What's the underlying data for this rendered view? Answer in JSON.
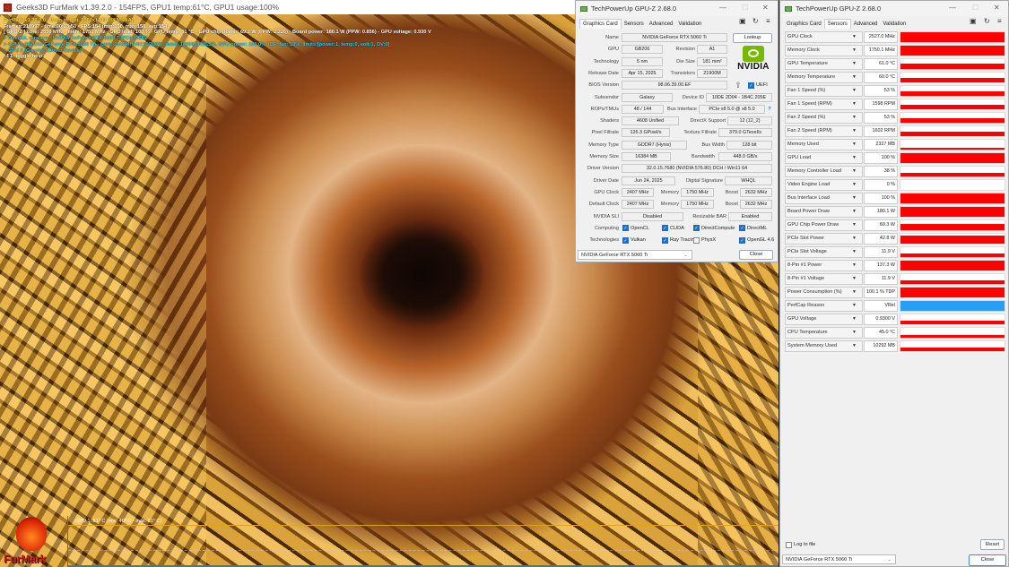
{
  "furmark": {
    "title": "Geeks3D FurMark v1.39.2.0 - 154FPS, GPU1 temp:61°C, GPU1 usage:100%",
    "osd": [
      {
        "c": "y",
        "t": "FurMark v1.39.2.0 - Burn-in test, 2560x1440 (0X MSAA)"
      },
      {
        "c": "w",
        "t": "Frames:218997 - time:00:23:50 - FPS:154 (min:150, max:158, avg:154)"
      },
      {
        "c": "w",
        "t": "[ GPU-Z ] core: 2550 MHz - mem: 1750 MHz - GPU load: 100 % - GPU temp: 61 °C - GPU chip power: 69.2 W (PPW: 2.226) - Board power: 180.1 W (PPW: 0.856) - GPU voltage: 0.930 V"
      },
      {
        "c": "c",
        "t": "> OpenGL renderer: NVIDIA GeForce RTX 5060 Ti/PCIe/SSE2"
      },
      {
        "c": "c",
        "t": "> GPU 1 (NVIDIA GeForce RTX 5060 Ti) - core: 2542MHz/61°C/100%, mem: 14000MHz/13%, GPU power: 100.0% TDP, fan: 53%, limits:[power:1, temp:0, volt:1, OV:0]"
      },
      {
        "c": "c",
        "t": "> GPU 2 (GraphicsDriver Device)"
      },
      {
        "c": "w",
        "t": "- F1: toggle help"
      }
    ],
    "graph_label": "GPU 1: 61° C (min: 40° C - max: 61° C)",
    "logo_text": "FurMark"
  },
  "gpuz1": {
    "title": "TechPowerUp GPU-Z 2.68.0",
    "tabs": [
      "Graphics Card",
      "Sensors",
      "Advanced",
      "Validation"
    ],
    "lookup": "Lookup",
    "vendor_logo": "NVIDIA",
    "rows": [
      {
        "label": "Name",
        "vals": [
          "NVIDIA GeForce RTX 5060 Ti"
        ]
      },
      {
        "label": "GPU",
        "vals": [
          "GB206",
          "Revision",
          "A1"
        ]
      },
      {
        "label": "Technology",
        "vals": [
          "5 nm",
          "Die Size",
          "181 mm²"
        ]
      },
      {
        "label": "Release Date",
        "vals": [
          "Apr 15, 2025",
          "Transistors",
          "21900M"
        ]
      },
      {
        "label": "BIOS Version",
        "vals": [
          "98.06.39.00.EF",
          "UEFI"
        ]
      },
      {
        "label": "Subvendor",
        "vals": [
          "Galaxy",
          "Device ID",
          "10DE 2D04 - 1B4C 205E"
        ]
      },
      {
        "label": "ROPs/TMUs",
        "vals": [
          "48 / 144",
          "Bus Interface",
          "PCIe x8 5.0 @ x8 5.0",
          "?"
        ]
      },
      {
        "label": "Shaders",
        "vals": [
          "4608 Unified",
          "DirectX Support",
          "12 (12_2)"
        ]
      },
      {
        "label": "Pixel Fillrate",
        "vals": [
          "126.3 GPixel/s",
          "Texture Fillrate",
          "379.0 GTexel/s"
        ]
      },
      {
        "label": "Memory Type",
        "vals": [
          "GDDR7 (Hynix)",
          "Bus Width",
          "128 bit"
        ]
      },
      {
        "label": "Memory Size",
        "vals": [
          "16384 MB",
          "Bandwidth",
          "448.0 GB/s"
        ]
      },
      {
        "label": "Driver Version",
        "vals": [
          "32.0.15.7680 (NVIDIA 576.80) DCH / Win11 64"
        ]
      },
      {
        "label": "Driver Date",
        "vals": [
          "Jun 24, 2025",
          "Digital Signature",
          "WHQL"
        ]
      },
      {
        "label": "GPU Clock",
        "vals": [
          "2407 MHz",
          "Memory",
          "1750 MHz",
          "Boost",
          "2632 MHz"
        ]
      },
      {
        "label": "Default Clock",
        "vals": [
          "2407 MHz",
          "Memory",
          "1750 MHz",
          "Boost",
          "2632 MHz"
        ]
      },
      {
        "label": "NVIDIA SLI",
        "vals": [
          "Disabled",
          "Resizable BAR",
          "Enabled"
        ]
      },
      {
        "label": "Computing",
        "checks": [
          {
            "t": "OpenCL",
            "on": true
          },
          {
            "t": "CUDA",
            "on": true
          },
          {
            "t": "DirectCompute",
            "on": true
          },
          {
            "t": "DirectML",
            "on": true
          }
        ]
      },
      {
        "label": "Technologies",
        "checks": [
          {
            "t": "Vulkan",
            "on": true
          },
          {
            "t": "Ray Tracing",
            "on": true
          },
          {
            "t": "PhysX",
            "on": false
          },
          {
            "t": "OpenGL 4.6",
            "on": true
          }
        ]
      }
    ],
    "gpu_select": "NVIDIA GeForce RTX 5060 Ti",
    "close": "Close",
    "uefi_checked": true
  },
  "gpuz2": {
    "title": "TechPowerUp GPU-Z 2.68.0",
    "tabs": [
      "Graphics Card",
      "Sensors",
      "Advanced",
      "Validation"
    ],
    "sensors": [
      {
        "name": "GPU Clock",
        "value": "2527.0 MHz",
        "level": 1.0
      },
      {
        "name": "Memory Clock",
        "value": "1750.1 MHz",
        "level": 1.0
      },
      {
        "name": "GPU Temperature",
        "value": "61.0 °C",
        "level": 0.55
      },
      {
        "name": "Memory Temperature",
        "value": "60.0 °C",
        "level": 0.45
      },
      {
        "name": "Fan 1 Speed (%)",
        "value": "53 %",
        "level": 0.5
      },
      {
        "name": "Fan 1 Speed (RPM)",
        "value": "1598 RPM",
        "level": 0.45
      },
      {
        "name": "Fan 2 Speed (%)",
        "value": "53 %",
        "level": 0.5
      },
      {
        "name": "Fan 2 Speed (RPM)",
        "value": "1602 RPM",
        "level": 0.45
      },
      {
        "name": "Memory Used",
        "value": "2327 MB",
        "level": 0.15
      },
      {
        "name": "GPU Load",
        "value": "100 %",
        "level": 1.0
      },
      {
        "name": "Memory Controller Load",
        "value": "38 %",
        "level": 0.35
      },
      {
        "name": "Video Engine Load",
        "value": "0 %",
        "level": 0
      },
      {
        "name": "Bus Interface Load",
        "value": "100 %",
        "level": 1.0
      },
      {
        "name": "Board Power Draw",
        "value": "180.1 W",
        "level": 1.0
      },
      {
        "name": "GPU Chip Power Draw",
        "value": "69.3 W",
        "level": 0.6
      },
      {
        "name": "PCIe Slot Power",
        "value": "42.8 W",
        "level": 0.85
      },
      {
        "name": "PCIe Slot Voltage",
        "value": "11.9 V",
        "level": 0.4
      },
      {
        "name": "8-Pin #1 Power",
        "value": "137.3 W",
        "level": 1.0
      },
      {
        "name": "8-Pin #1 Voltage",
        "value": "11.9 V",
        "level": 0.35
      },
      {
        "name": "Power Consumption (%)",
        "value": "100.1 % TDP",
        "level": 1.0
      },
      {
        "name": "PerfCap Reason",
        "value": "VRel",
        "level": 1.0,
        "color": "#2a9df4"
      },
      {
        "name": "GPU Voltage",
        "value": "0.9300 V",
        "level": 0.4
      },
      {
        "name": "CPU Temperature",
        "value": "45.0 °C",
        "level": 0.3
      },
      {
        "name": "System Memory Used",
        "value": "10292 MB",
        "level": 0.4
      }
    ],
    "log_to_file": "Log to file",
    "reset": "Reset",
    "gpu_select": "NVIDIA GeForce RTX 5060 Ti",
    "close": "Close"
  },
  "colors": {
    "graph_bar": "#ff0000",
    "perfcap": "#2a9df4",
    "nvidia_green": "#76b900"
  }
}
